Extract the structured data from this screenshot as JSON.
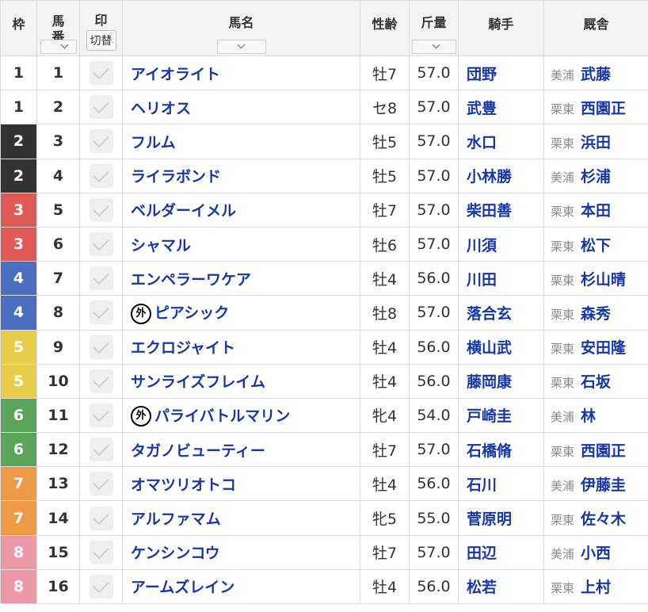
{
  "headers": {
    "waku": "枠",
    "umaban": "馬\n番",
    "umaban_line1": "馬",
    "umaban_line2": "番",
    "mark": "印",
    "mark_toggle": "切替",
    "name": "馬名",
    "sex_age": "性齢",
    "weight": "斤量",
    "jockey": "騎手",
    "stable": "厩舎"
  },
  "colors": {
    "waku_1": "#ffffff",
    "waku_2": "#333333",
    "waku_3": "#e05a55",
    "waku_4": "#4a6fc0",
    "waku_5": "#e8cd4a",
    "waku_6": "#5aa55a",
    "waku_7": "#ed9a46",
    "waku_8": "#ec98a9",
    "link": "#1537a8"
  },
  "rows": [
    {
      "waku": "1",
      "umaban": "1",
      "foreign": false,
      "name": "アイオライト",
      "sex_age": "牡7",
      "weight": "57.0",
      "jockey": "団野",
      "region": "美浦",
      "trainer": "武藤"
    },
    {
      "waku": "1",
      "umaban": "2",
      "foreign": false,
      "name": "ヘリオス",
      "sex_age": "セ8",
      "weight": "57.0",
      "jockey": "武豊",
      "region": "栗東",
      "trainer": "西園正"
    },
    {
      "waku": "2",
      "umaban": "3",
      "foreign": false,
      "name": "フルム",
      "sex_age": "牡5",
      "weight": "57.0",
      "jockey": "水口",
      "region": "栗東",
      "trainer": "浜田"
    },
    {
      "waku": "2",
      "umaban": "4",
      "foreign": false,
      "name": "ライラボンド",
      "sex_age": "牡5",
      "weight": "57.0",
      "jockey": "小林勝",
      "region": "美浦",
      "trainer": "杉浦"
    },
    {
      "waku": "3",
      "umaban": "5",
      "foreign": false,
      "name": "ベルダーイメル",
      "sex_age": "牡7",
      "weight": "57.0",
      "jockey": "柴田善",
      "region": "栗東",
      "trainer": "本田"
    },
    {
      "waku": "3",
      "umaban": "6",
      "foreign": false,
      "name": "シャマル",
      "sex_age": "牡6",
      "weight": "57.0",
      "jockey": "川須",
      "region": "栗東",
      "trainer": "松下"
    },
    {
      "waku": "4",
      "umaban": "7",
      "foreign": false,
      "name": "エンペラーワケア",
      "sex_age": "牡4",
      "weight": "56.0",
      "jockey": "川田",
      "region": "栗東",
      "trainer": "杉山晴"
    },
    {
      "waku": "4",
      "umaban": "8",
      "foreign": true,
      "foreign_mark": "外",
      "name": "ピアシック",
      "sex_age": "牡8",
      "weight": "57.0",
      "jockey": "落合玄",
      "region": "栗東",
      "trainer": "森秀"
    },
    {
      "waku": "5",
      "umaban": "9",
      "foreign": false,
      "name": "エクロジャイト",
      "sex_age": "牡4",
      "weight": "56.0",
      "jockey": "横山武",
      "region": "栗東",
      "trainer": "安田隆"
    },
    {
      "waku": "5",
      "umaban": "10",
      "foreign": false,
      "name": "サンライズフレイム",
      "sex_age": "牡4",
      "weight": "56.0",
      "jockey": "藤岡康",
      "region": "栗東",
      "trainer": "石坂"
    },
    {
      "waku": "6",
      "umaban": "11",
      "foreign": true,
      "foreign_mark": "外",
      "name": "パライバトルマリン",
      "sex_age": "牝4",
      "weight": "54.0",
      "jockey": "戸崎圭",
      "region": "美浦",
      "trainer": "林"
    },
    {
      "waku": "6",
      "umaban": "12",
      "foreign": false,
      "name": "タガノビューティー",
      "sex_age": "牡7",
      "weight": "57.0",
      "jockey": "石橋脩",
      "region": "栗東",
      "trainer": "西園正"
    },
    {
      "waku": "7",
      "umaban": "13",
      "foreign": false,
      "name": "オマツリオトコ",
      "sex_age": "牡4",
      "weight": "56.0",
      "jockey": "石川",
      "region": "美浦",
      "trainer": "伊藤圭"
    },
    {
      "waku": "7",
      "umaban": "14",
      "foreign": false,
      "name": "アルファマム",
      "sex_age": "牝5",
      "weight": "55.0",
      "jockey": "菅原明",
      "region": "栗東",
      "trainer": "佐々木"
    },
    {
      "waku": "8",
      "umaban": "15",
      "foreign": false,
      "name": "ケンシンコウ",
      "sex_age": "牡7",
      "weight": "57.0",
      "jockey": "田辺",
      "region": "美浦",
      "trainer": "小西"
    },
    {
      "waku": "8",
      "umaban": "16",
      "foreign": false,
      "name": "アームズレイン",
      "sex_age": "牡4",
      "weight": "56.0",
      "jockey": "松若",
      "region": "栗東",
      "trainer": "上村"
    }
  ]
}
